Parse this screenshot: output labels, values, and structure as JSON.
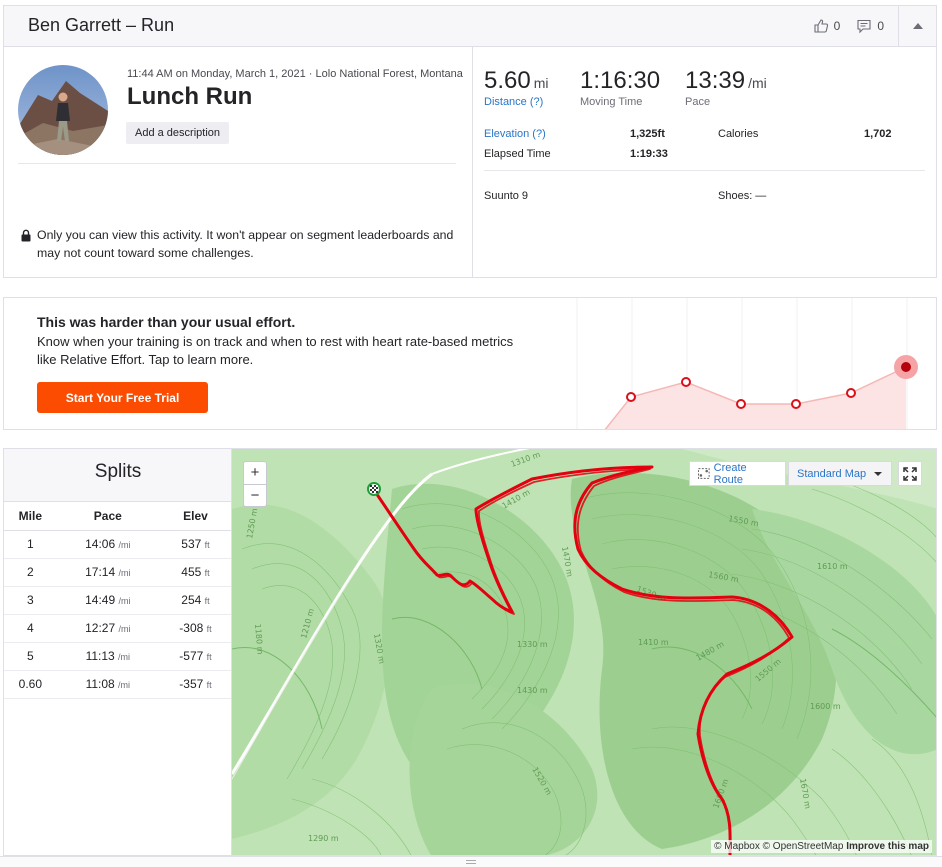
{
  "header": {
    "title": "Ben Garrett – Run",
    "kudos_count": "0",
    "comments_count": "0"
  },
  "activity": {
    "meta": "11:44 AM on Monday, March 1, 2021 · Lolo National Forest, Montana",
    "name": "Lunch Run",
    "add_description": "Add a description",
    "privacy": "Only you can view this activity. It won't appear on segment leaderboards and may not count toward some challenges."
  },
  "stats": {
    "distance": {
      "value": "5.60",
      "unit": "mi",
      "label": "Distance (?)"
    },
    "moving_time": {
      "value": "1:16:30",
      "label": "Moving Time"
    },
    "pace": {
      "value": "13:39",
      "unit": "/mi",
      "label": "Pace"
    },
    "elevation_label": "Elevation (?)",
    "elevation_value": "1,325ft",
    "calories_label": "Calories",
    "calories_value": "1,702",
    "elapsed_label": "Elapsed Time",
    "elapsed_value": "1:19:33",
    "device": "Suunto 9",
    "shoes": "Shoes: —"
  },
  "effort": {
    "title": "This was harder than your usual effort.",
    "body": "Know when your training is on track and when to rest with heart rate-based metrics like Relative Effort. Tap to learn more.",
    "cta": "Start Your Free Trial"
  },
  "splits": {
    "title": "Splits",
    "columns": [
      "Mile",
      "Pace",
      "Elev"
    ],
    "pace_unit": "/mi",
    "elev_unit": "ft",
    "rows": [
      {
        "mile": "1",
        "pace": "14:06",
        "elev": "537"
      },
      {
        "mile": "2",
        "pace": "17:14",
        "elev": "455"
      },
      {
        "mile": "3",
        "pace": "14:49",
        "elev": "254"
      },
      {
        "mile": "4",
        "pace": "12:27",
        "elev": "-308"
      },
      {
        "mile": "5",
        "pace": "11:13",
        "elev": "-577"
      },
      {
        "mile": "0.60",
        "pace": "11:08",
        "elev": "-357"
      }
    ]
  },
  "map": {
    "zoom_in": "+",
    "zoom_out": "−",
    "create_route": "Create Route",
    "map_style": "Standard Map",
    "attribution_mapbox": "© Mapbox",
    "attribution_osm": "© OpenStreetMap",
    "attribution_improve": "Improve this map",
    "contour_labels": [
      "1310 m",
      "1410 m",
      "1470 m",
      "1530 m",
      "1560 m",
      "1550 m",
      "1610 m",
      "1410 m",
      "1480 m",
      "1330 m",
      "1550 m",
      "1430 m",
      "1600 m",
      "1320 m",
      "1210 m",
      "1180 m",
      "1250 m",
      "1520 m",
      "1690 m",
      "1670 m",
      "1290 m"
    ]
  },
  "colors": {
    "brand": "#fc4c02",
    "link": "#2a75c6",
    "route": "#e3000f",
    "map_green": "#a9d7a0"
  }
}
